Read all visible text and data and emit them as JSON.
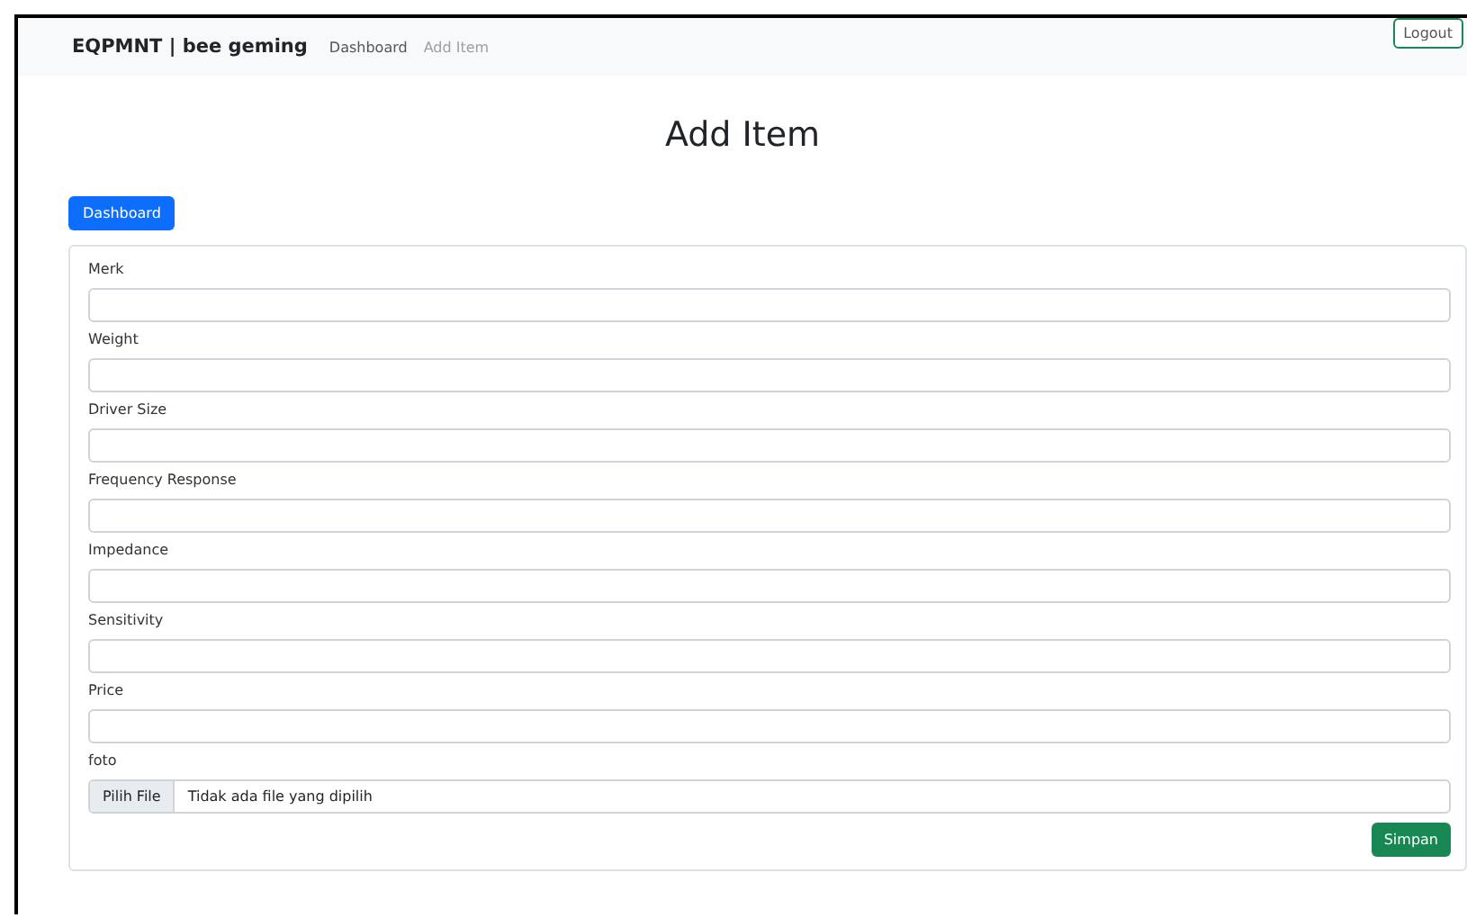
{
  "navbar": {
    "brand": "EQPMNT | bee geming",
    "links": [
      {
        "label": "Dashboard",
        "selected": true
      },
      {
        "label": "Add Item",
        "selected": false
      }
    ],
    "logout": "Logout"
  },
  "title": "Add Item",
  "back_button": "Dashboard",
  "form": {
    "fields": [
      {
        "kind": "text",
        "label": "Merk"
      },
      {
        "kind": "text",
        "label": "Weight"
      },
      {
        "kind": "text",
        "label": "Driver Size"
      },
      {
        "kind": "text",
        "label": "Frequency Response"
      },
      {
        "kind": "text",
        "label": "Impedance"
      },
      {
        "kind": "text",
        "label": "Sensitivity"
      },
      {
        "kind": "text",
        "label": "Price"
      },
      {
        "kind": "file",
        "label": "foto",
        "button": "Pilih File",
        "status": "Tidak ada file yang dipilih"
      }
    ],
    "submit": "Simpan"
  }
}
